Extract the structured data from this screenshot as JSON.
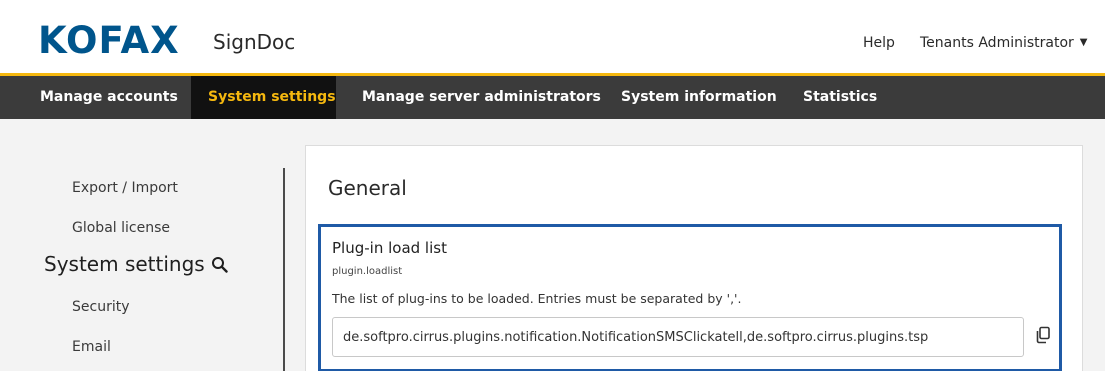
{
  "header": {
    "logo": "KOFAX",
    "product": "SignDoc",
    "help_label": "Help",
    "user_label": "Tenants Administrator",
    "colors": {
      "brand": "#00558c",
      "accent": "#f5b80f"
    }
  },
  "nav": {
    "items": [
      {
        "label": "Manage accounts"
      },
      {
        "label": "System settings",
        "active": true
      },
      {
        "label": "Manage server administrators"
      },
      {
        "label": "System information"
      },
      {
        "label": "Statistics"
      }
    ]
  },
  "sidebar": {
    "links_top": [
      {
        "label": "Export / Import"
      },
      {
        "label": "Global license"
      }
    ],
    "heading": "System settings",
    "heading_icon": "search-icon",
    "links_bottom": [
      {
        "label": "Security"
      },
      {
        "label": "Email"
      }
    ]
  },
  "main": {
    "section_title": "General",
    "setting": {
      "title": "Plug-in load list",
      "key": "plugin.loadlist",
      "description": "The list of plug-ins to be loaded. Entries must be separated by ','.",
      "value": "de.softpro.cirrus.plugins.notification.NotificationSMSClickatell,de.softpro.cirrus.plugins.tsp",
      "action_icon": "copy-icon"
    }
  }
}
